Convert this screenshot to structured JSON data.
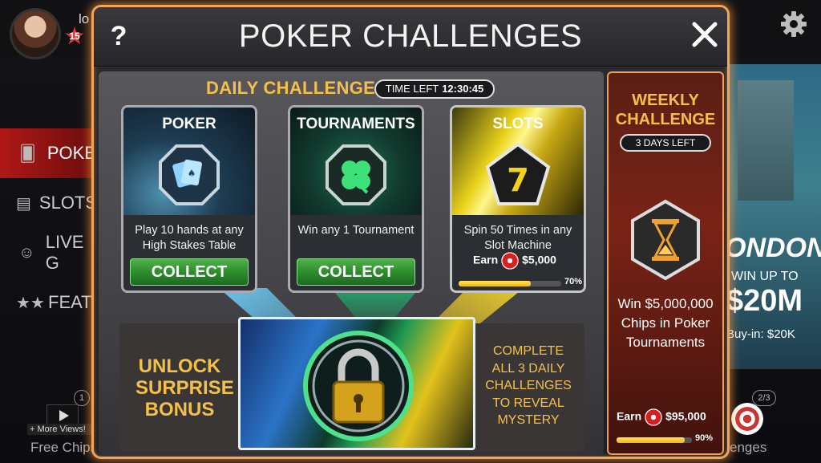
{
  "background": {
    "user_name": "lo",
    "level": "15",
    "nav_items": [
      {
        "label": "POKE",
        "icon": "cards-icon"
      },
      {
        "label": "SLOTS",
        "icon": "slot-reels-icon"
      },
      {
        "label": "LIVE G",
        "icon": "dealer-icon"
      },
      {
        "label": "FEATU",
        "icon": "stars-icon"
      }
    ],
    "bottom_left": {
      "badge": "1",
      "more_views": "+ More Views!",
      "label": "Free Chips"
    },
    "promo": {
      "city": "ONDON",
      "win_up_to": "WIN UP TO",
      "amount": "$20M",
      "buyin": "Buy-in: $20K"
    },
    "bottom_right": {
      "badge": "2/3",
      "label": "enges"
    }
  },
  "modal": {
    "title": "POKER CHALLENGES",
    "help_label": "?",
    "daily": {
      "title": "DAILY CHALLENGE",
      "time_left_label": "TIME LEFT",
      "time_left_value": "12:30:45",
      "cards": [
        {
          "title": "POKER",
          "icon": "playing-cards-icon",
          "desc": "Play 10 hands at any High Stakes Table",
          "button": "COLLECT"
        },
        {
          "title": "TOURNAMENTS",
          "icon": "clover-icon",
          "desc": "Win any 1 Tournament",
          "button": "COLLECT"
        },
        {
          "title": "SLOTS",
          "icon": "lucky-seven-icon",
          "desc": "Spin 50 Times in any Slot Machine",
          "earn_label": "Earn",
          "earn_value": "$5,000",
          "progress": 0.7,
          "progress_label": "70%"
        }
      ],
      "bonus": {
        "unlock_text": "UNLOCK SURPRISE BONUS",
        "lock_icon": "padlock-icon",
        "complete_text": "COMPLETE ALL 3 DAILY CHALLENGES TO REVEAL MYSTERY"
      }
    },
    "weekly": {
      "title": "WEEKLY CHALLENGE",
      "days_left": "3 DAYS LEFT",
      "icon": "hourglass-icon",
      "desc": "Win $5,000,000 Chips in Poker Tournaments",
      "earn_label": "Earn",
      "earn_value": "$95,000",
      "progress": 0.9,
      "progress_label": "90%"
    }
  },
  "colors": {
    "accent_gold": "#f5c04a",
    "collect_green": "#2a8a2b",
    "frame_orange": "#f2a35c",
    "active_nav_red": "#b01818"
  }
}
